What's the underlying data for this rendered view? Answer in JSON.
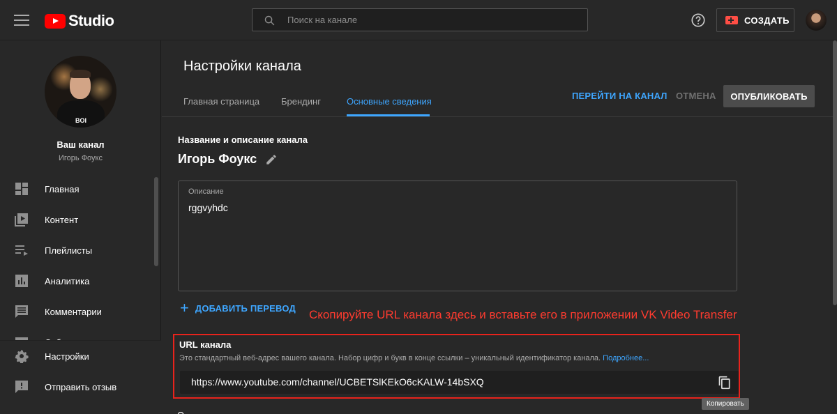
{
  "header": {
    "logo_text": "Studio",
    "search_placeholder": "Поиск на канале",
    "create_label": "СОЗДАТЬ"
  },
  "sidebar": {
    "avatar_shirt_text": "BOI",
    "channel_label": "Ваш канал",
    "channel_name": "Игорь Фоукс",
    "items": [
      {
        "label": "Главная",
        "icon": "dashboard-icon"
      },
      {
        "label": "Контент",
        "icon": "content-icon"
      },
      {
        "label": "Плейлисты",
        "icon": "playlists-icon"
      },
      {
        "label": "Аналитика",
        "icon": "analytics-icon"
      },
      {
        "label": "Комментарии",
        "icon": "comments-icon"
      },
      {
        "label": "Субтитры",
        "icon": "subtitles-icon"
      }
    ],
    "bottom_items": [
      {
        "label": "Настройки",
        "icon": "settings-icon"
      },
      {
        "label": "Отправить отзыв",
        "icon": "feedback-icon"
      }
    ]
  },
  "main": {
    "title": "Настройки канала",
    "tabs": [
      {
        "label": "Главная страница"
      },
      {
        "label": "Брендинг"
      },
      {
        "label": "Основные сведения",
        "active": true
      }
    ],
    "actions": {
      "goto_channel": "ПЕРЕЙТИ НА КАНАЛ",
      "cancel": "ОТМЕНА",
      "publish": "ОПУБЛИКОВАТЬ"
    },
    "section_title": "Название и описание канала",
    "channel_name": "Игорь Фоукс",
    "description": {
      "label": "Описание",
      "value": "rggvyhdc"
    },
    "add_translation": "ДОБАВИТЬ ПЕРЕВОД",
    "annotation": "Скопируйте URL канала здесь и вставьте его в приложении VK Video Transfer",
    "url_section": {
      "title": "URL канала",
      "description": "Это стандартный веб-адрес вашего канала. Набор цифр и букв в конце ссылки – уникальный идентификатор канала.",
      "more_link": "Подробнее...",
      "url": "https://www.youtube.com/channel/UCBETSlKEkO6cKALW-14bSXQ",
      "copy_tooltip": "Копировать"
    },
    "next_section_letter": "О"
  },
  "colors": {
    "background": "#282828",
    "accent_blue": "#3ea6ff",
    "brand_red": "#ff0000",
    "annotation_red": "#e8231c"
  }
}
